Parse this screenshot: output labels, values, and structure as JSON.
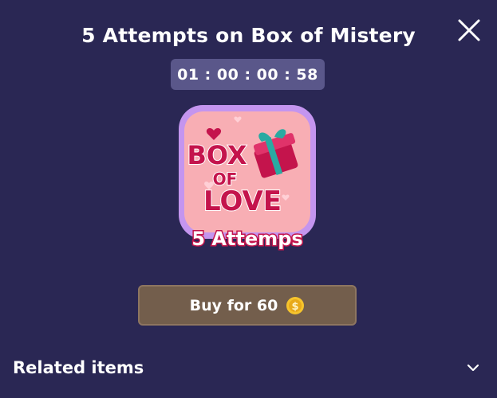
{
  "header": {
    "title": "5 Attempts on Box of Mistery",
    "close_icon": "close-icon"
  },
  "timer": {
    "value": "01 : 00 : 00 : 58"
  },
  "item": {
    "image_text_top": "BOX",
    "image_text_mid": "OF",
    "image_text_bottom": "LOVE",
    "image_caption": "5 Attemps",
    "colors": {
      "frame": "#c495ef",
      "tile": "#f8aeb4",
      "text": "#c4144c",
      "gift_ribbon": "#2aaaa2"
    }
  },
  "buy": {
    "label": "Buy for 60",
    "currency_icon": "coin-icon"
  },
  "related": {
    "label": "Related items",
    "chevron_icon": "chevron-down-icon"
  }
}
